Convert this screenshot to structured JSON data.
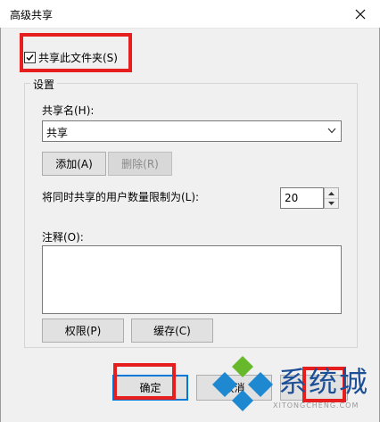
{
  "window": {
    "title": "高级共享"
  },
  "share_checkbox": {
    "label": "共享此文件夹(S)",
    "checked": true
  },
  "settings": {
    "legend": "设置",
    "share_name_label": "共享名(H):",
    "share_name_value": "共享",
    "add_button": "添加(A)",
    "remove_button": "删除(R)",
    "user_limit_label": "将同时共享的用户数量限制为(L):",
    "user_limit_value": "20",
    "comment_label": "注释(O):",
    "comment_value": "",
    "permissions_button": "权限(P)",
    "caching_button": "缓存(C)"
  },
  "footer": {
    "ok_button": "确定",
    "cancel_button": "取消"
  },
  "watermark": {
    "brand": "系统城",
    "url": "XITONGCHENG.COM"
  },
  "colors": {
    "highlight": "#e61e1e",
    "accent": "#0078d7",
    "watermark_blue": "#1d4f97",
    "watermark_green": "#67b82a"
  },
  "icons": {
    "close": "close-icon",
    "dropdown": "chevron-down-icon",
    "spin_up": "triangle-up-icon",
    "spin_down": "triangle-down-icon",
    "check": "checkmark-icon"
  }
}
